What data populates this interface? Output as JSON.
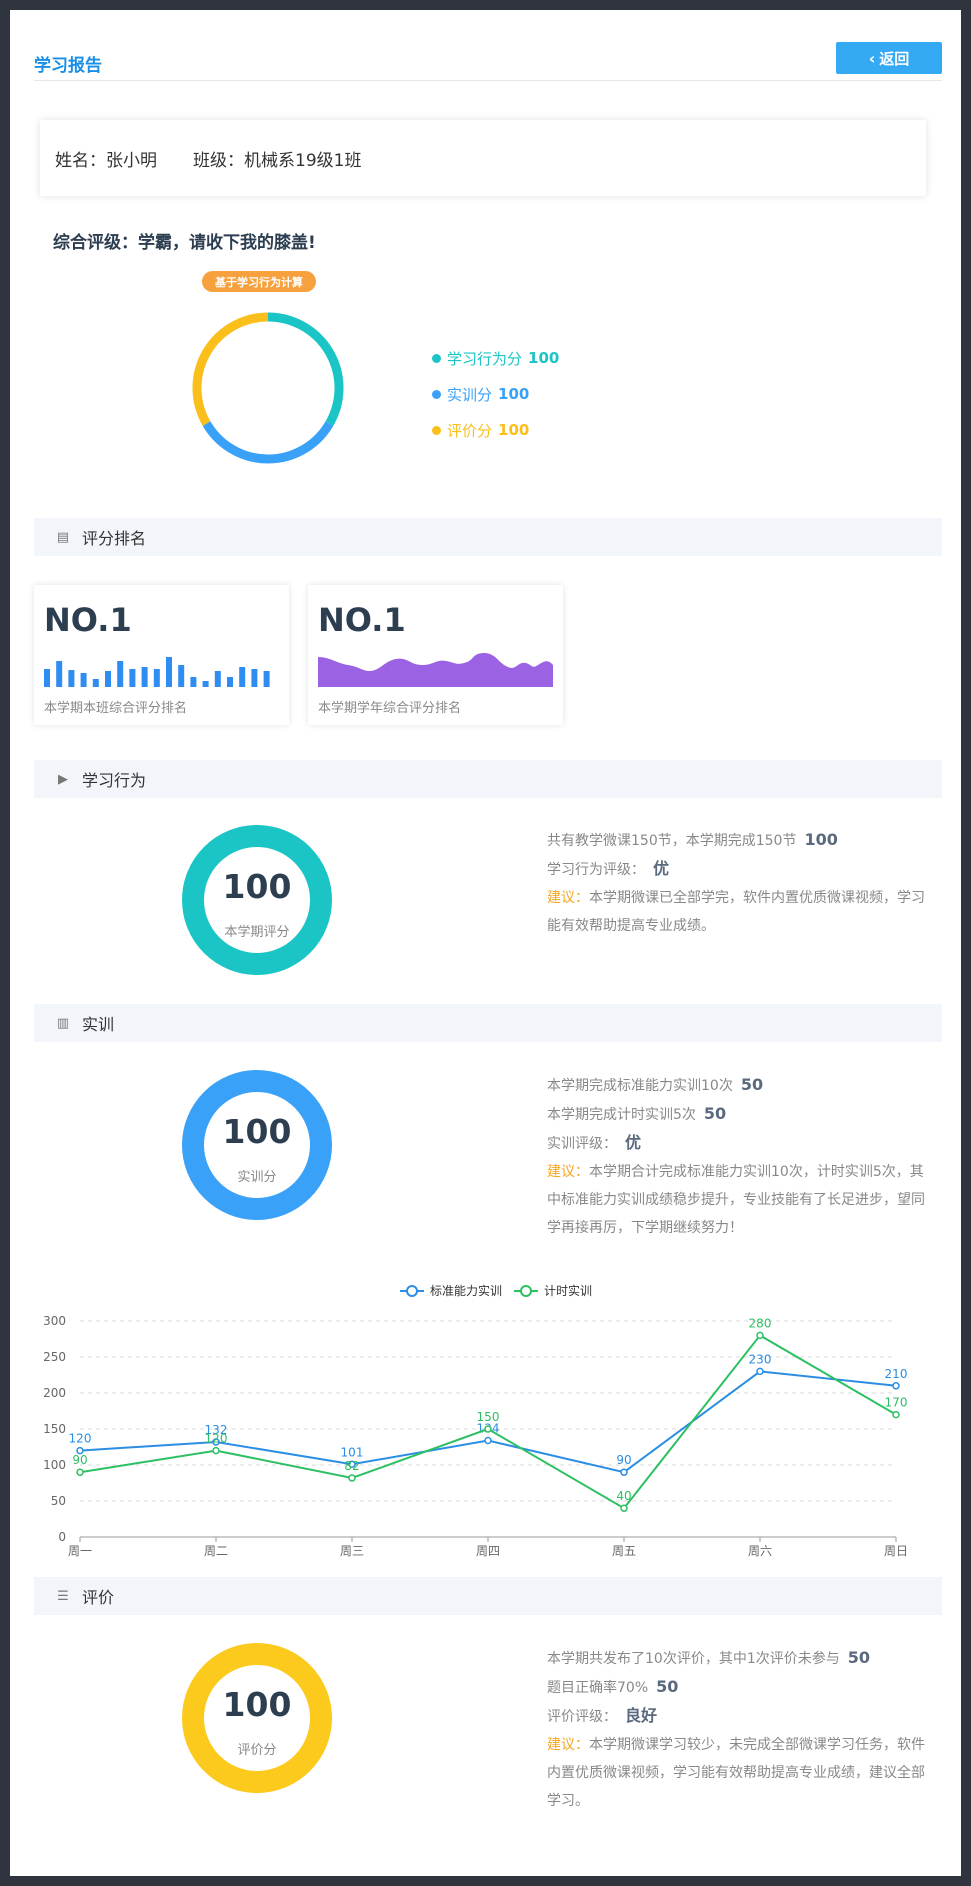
{
  "header": {
    "title": "学习报告",
    "back_label": "返回"
  },
  "student": {
    "name_label": "姓名：张小明",
    "class_label": "班级：机械系19级1班"
  },
  "overall": {
    "title": "综合评级：学霸，请收下我的膝盖!",
    "badge": "基于学习行为计算",
    "legend": [
      {
        "label": "学习行为分",
        "value": "100",
        "color": "#1cc5c5"
      },
      {
        "label": "实训分",
        "value": "100",
        "color": "#3aa1f8"
      },
      {
        "label": "评价分",
        "value": "100",
        "color": "#fbbf1c"
      }
    ]
  },
  "ranking": {
    "section_title": "评分排名",
    "cards": [
      {
        "rank": "NO.1",
        "caption": "本学期本班综合评分排名",
        "color": "#2f8cf0"
      },
      {
        "rank": "NO.1",
        "caption": "本学期学年综合评分排名",
        "color": "#9b63e4"
      }
    ]
  },
  "behavior": {
    "section_title": "学习行为",
    "score": "100",
    "score_label": "本学期评分",
    "color": "#1cc5c5",
    "lines": [
      {
        "text": "共有教学微课150节，本学期完成150节",
        "value": "100"
      },
      {
        "text": "学习行为评级：",
        "value": "优"
      }
    ],
    "advice_label": "建议：",
    "advice": "本学期微课已全部学完，软件内置优质微课视频，学习能有效帮助提高专业成绩。"
  },
  "training": {
    "section_title": "实训",
    "score": "100",
    "score_label": "实训分",
    "color": "#3aa1f8",
    "lines": [
      {
        "text": "本学期完成标准能力实训10次",
        "value": "50"
      },
      {
        "text": "本学期完成计时实训5次",
        "value": "50"
      },
      {
        "text": "实训评级：",
        "value": "优"
      }
    ],
    "advice_label": "建议：",
    "advice": "本学期合计完成标准能力实训10次，计时实训5次，其中标准能力实训成绩稳步提升，专业技能有了长足进步，望同学再接再厉，下学期继续努力！"
  },
  "evaluation": {
    "section_title": "评价",
    "score": "100",
    "score_label": "评价分",
    "color": "#fbca1c",
    "lines": [
      {
        "text": "本学期共发布了10次评价，其中1次评价未参与",
        "value": "50"
      },
      {
        "text": "题目正确率70%",
        "value": "50"
      },
      {
        "text": "评价评级：",
        "value": "良好"
      }
    ],
    "advice_label": "建议：",
    "advice": "本学期微课学习较少，未完成全部微课学习任务，软件内置优质微课视频，学习能有效帮助提高专业成绩，建议全部学习。"
  },
  "chart_data": {
    "type": "line",
    "categories": [
      "周一",
      "周二",
      "周三",
      "周四",
      "周五",
      "周六",
      "周日"
    ],
    "series": [
      {
        "name": "标准能力实训",
        "values": [
          120,
          132,
          101,
          134,
          90,
          230,
          210
        ],
        "color": "#2b8de3"
      },
      {
        "name": "计时实训",
        "values": [
          90,
          120,
          82,
          150,
          40,
          280,
          170
        ],
        "color": "#2cc063"
      }
    ],
    "yticks": [
      0,
      50,
      100,
      150,
      200,
      250,
      300
    ],
    "ylim": [
      0,
      300
    ],
    "grid": true,
    "legend_position": "top-center"
  }
}
